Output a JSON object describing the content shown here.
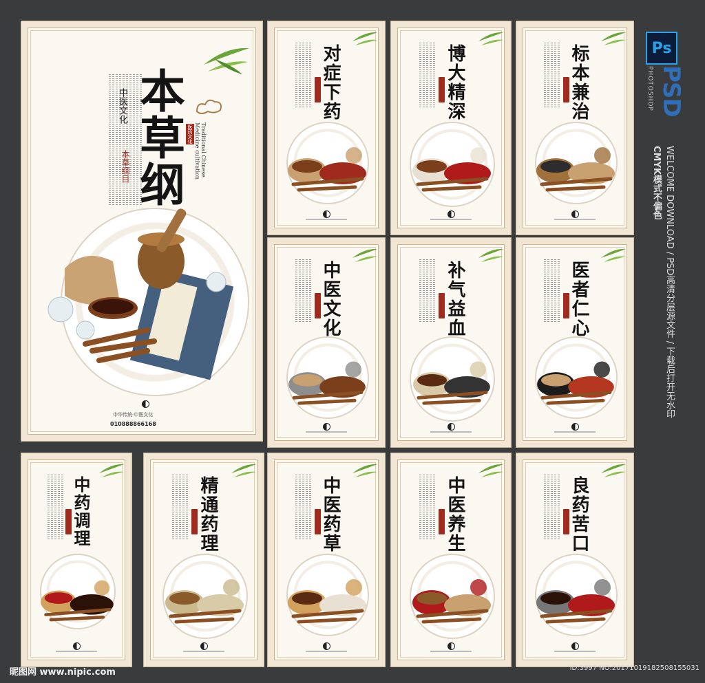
{
  "main_poster": {
    "title": "本草纲目",
    "series_label": "中医文化",
    "seal_vertical": "本草纲目",
    "red_seal": "医药文化",
    "english": "Traditional Chinese Medicine cultivation",
    "footer_brand": "中华传统·中医文化",
    "phone": "010888866168"
  },
  "posters": [
    {
      "title": "对症下药"
    },
    {
      "title": "博大精深"
    },
    {
      "title": "标本兼治"
    },
    {
      "title": "中医文化"
    },
    {
      "title": "补气益血"
    },
    {
      "title": "医者仁心"
    },
    {
      "title": "中药调理"
    },
    {
      "title": "精通药理"
    },
    {
      "title": "中医药草"
    },
    {
      "title": "中医养生"
    },
    {
      "title": "良药苦口"
    }
  ],
  "side_banner": {
    "ps_label": "Ps",
    "psd_label": "PSD",
    "photoshop_label": "PHOTOSHOP",
    "cmyk_text": "CMYK模式不偏色",
    "welcome_text": "WELCOME DOWNLOAD / PSD高清分层源文件 / 下载后打开无水印"
  },
  "watermark": "昵图网 www.nipic.com",
  "image_id": "ID:3997 NO:20171019182508155031",
  "colors": {
    "background": "#3a3b3d",
    "panel": "#f1e6d4",
    "seal_red": "#a12a1f",
    "psd_blue": "#2f6fb8"
  }
}
